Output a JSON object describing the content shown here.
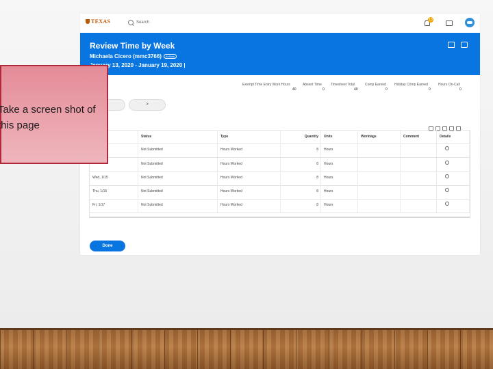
{
  "workday": {
    "logo_text": "TEXAS",
    "search_placeholder": "Search",
    "notifications_count": "13",
    "page_title": "Review Time by Week",
    "person": "Michaela Cicero (mmc3766)",
    "person_badge": "Actions",
    "dates": "January 13, 2020 - January 19, 2020  |",
    "summary": [
      {
        "label": "Exempt Time Entry Work Hours",
        "value": "40"
      },
      {
        "label": "Absent Time",
        "value": "0"
      },
      {
        "label": "Timesheet Total",
        "value": "40"
      },
      {
        "label": "Comp Earned",
        "value": "0"
      },
      {
        "label": "Holiday Comp Earned",
        "value": "0"
      },
      {
        "label": "Hours On-Call",
        "value": "0"
      }
    ],
    "next_label": ">",
    "columns": [
      "",
      "Status",
      "Type",
      "Quantity",
      "Units",
      "Worktags",
      "Comment",
      "Details"
    ],
    "rows": [
      {
        "day": "",
        "status": "Not Submitted",
        "type": "Hours Worked",
        "qty": "8",
        "units": "Hours"
      },
      {
        "day": "",
        "status": "Not Submitted",
        "type": "Hours Worked",
        "qty": "8",
        "units": "Hours"
      },
      {
        "day": "Wed, 1/15",
        "status": "Not Submitted",
        "type": "Hours Worked",
        "qty": "8",
        "units": "Hours"
      },
      {
        "day": "Thu, 1/16",
        "status": "Not Submitted",
        "type": "Hours Worked",
        "qty": "8",
        "units": "Hours"
      },
      {
        "day": "Fri, 1/17",
        "status": "Not Submitted",
        "type": "Hours Worked",
        "qty": "8",
        "units": "Hours"
      }
    ],
    "done_label": "Done"
  },
  "callout": {
    "line1": "Take a screen shot of",
    "line2": "this page"
  },
  "colors": {
    "header_blue": "#0875e1",
    "callout_border": "#b0283b",
    "callout_fill": "#e48c98"
  },
  "icons": [
    "search-icon",
    "bell-icon",
    "inbox-icon",
    "avatar-icon",
    "export-icon",
    "print-icon",
    "filter-icon",
    "magnifier-icon"
  ]
}
